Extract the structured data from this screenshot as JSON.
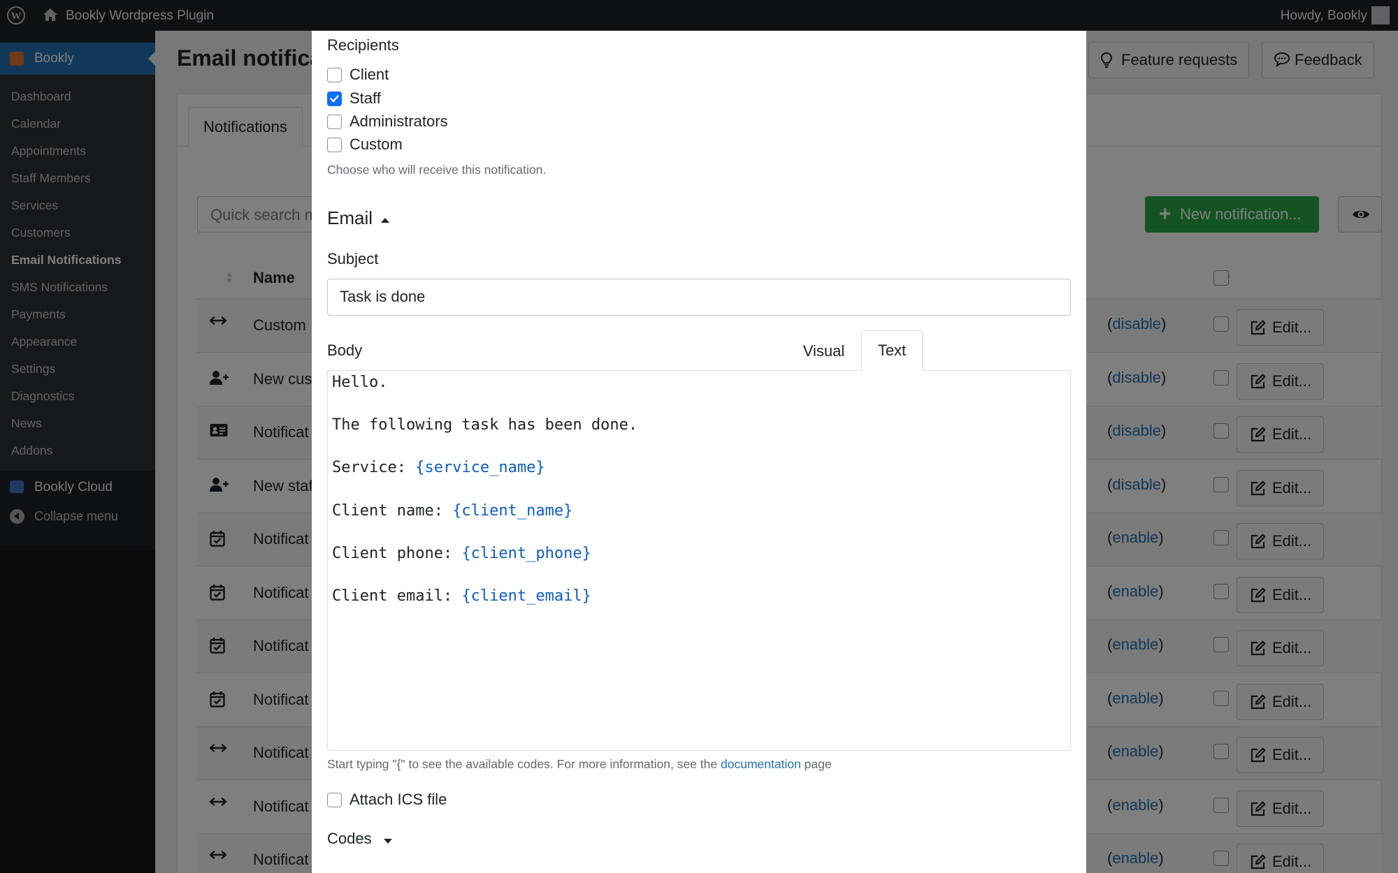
{
  "admin_bar": {
    "site_name": "Bookly Wordpress Plugin",
    "howdy": "Howdy, Bookly"
  },
  "sidebar": {
    "app_label": "Bookly",
    "items": [
      {
        "label": "Dashboard"
      },
      {
        "label": "Calendar"
      },
      {
        "label": "Appointments"
      },
      {
        "label": "Staff Members"
      },
      {
        "label": "Services"
      },
      {
        "label": "Customers"
      },
      {
        "label": "Email Notifications",
        "current": true
      },
      {
        "label": "SMS Notifications"
      },
      {
        "label": "Payments"
      },
      {
        "label": "Appearance"
      },
      {
        "label": "Settings"
      },
      {
        "label": "Diagnostics"
      },
      {
        "label": "News"
      },
      {
        "label": "Addons"
      }
    ],
    "cloud_label": "Bookly Cloud",
    "collapse_label": "Collapse menu"
  },
  "page": {
    "title": "Email notifica",
    "feature_requests": "Feature requests",
    "feedback": "Feedback",
    "tab_notifications": "Notifications",
    "search_placeholder": "Quick search n",
    "new_notification": "New notification...",
    "col_name": "Name",
    "rows": [
      {
        "icon": "arrows-h-icon",
        "name": "Custom",
        "status_open": "(",
        "action": "disable",
        "status_close": ")",
        "edit": "Edit..."
      },
      {
        "icon": "user-plus-icon",
        "name": "New cus",
        "status_open": "(",
        "action": "disable",
        "status_close": ")",
        "edit": "Edit..."
      },
      {
        "icon": "id-card-icon",
        "name": "Notificat",
        "status_open": "(",
        "action": "disable",
        "status_close": ")",
        "edit": "Edit..."
      },
      {
        "icon": "user-plus-icon",
        "name": "New staf",
        "status_open": "(",
        "action": "disable",
        "status_close": ")",
        "edit": "Edit..."
      },
      {
        "icon": "calendar-check-icon",
        "name": "Notificat",
        "status_open": "(",
        "action": "enable",
        "status_close": ")",
        "edit": "Edit..."
      },
      {
        "icon": "calendar-check-icon",
        "name": "Notificat",
        "status_open": "(",
        "action": "enable",
        "status_close": ")",
        "edit": "Edit..."
      },
      {
        "icon": "calendar-check-icon",
        "name": "Notificat",
        "status_open": "(",
        "action": "enable",
        "status_close": ")",
        "edit": "Edit..."
      },
      {
        "icon": "calendar-check-icon",
        "name": "Notificat",
        "status_open": "(",
        "action": "enable",
        "status_close": ")",
        "edit": "Edit..."
      },
      {
        "icon": "arrows-h-icon",
        "name": "Notificat",
        "status_open": "(",
        "action": "enable",
        "status_close": ")",
        "edit": "Edit..."
      },
      {
        "icon": "arrows-h-icon",
        "name": "Notificat",
        "status_open": "(",
        "action": "enable",
        "status_close": ")",
        "edit": "Edit..."
      },
      {
        "icon": "arrows-h-icon",
        "name": "Notificat",
        "status_open": "(",
        "action": "enable",
        "status_close": ")",
        "edit": "Edit..."
      }
    ]
  },
  "modal": {
    "recipients_label": "Recipients",
    "recipients": [
      {
        "label": "Client",
        "checked": false
      },
      {
        "label": "Staff",
        "checked": true
      },
      {
        "label": "Administrators",
        "checked": false
      },
      {
        "label": "Custom",
        "checked": false
      }
    ],
    "recipients_help": "Choose who will receive this notification.",
    "email_heading": "Email",
    "subject_label": "Subject",
    "subject_value": "Task is done",
    "body_label": "Body",
    "tab_visual": "Visual",
    "tab_text": "Text",
    "body_lines": [
      {
        "text": "Hello.",
        "code": ""
      },
      {
        "text": "",
        "code": ""
      },
      {
        "text": "The following task has been done.",
        "code": ""
      },
      {
        "text": "",
        "code": ""
      },
      {
        "text": "Service: ",
        "code": "{service_name}"
      },
      {
        "text": "",
        "code": ""
      },
      {
        "text": "Client name: ",
        "code": "{client_name}"
      },
      {
        "text": "",
        "code": ""
      },
      {
        "text": "Client phone: ",
        "code": "{client_phone}"
      },
      {
        "text": "",
        "code": ""
      },
      {
        "text": "Client email: ",
        "code": "{client_email}"
      }
    ],
    "body_help_prefix": "Start typing \"{\" to see the available codes. For more information, see the ",
    "body_help_link": "documentation",
    "body_help_suffix": " page",
    "attach_ics_label": "Attach ICS file",
    "attach_ics_checked": false,
    "codes_label": "Codes"
  },
  "colors": {
    "wp_dark": "#1d2327",
    "wp_blue": "#2271b1",
    "success_green": "#28a745",
    "checkbox_blue": "#0d6efd",
    "code_blue": "#0d5fc5"
  }
}
